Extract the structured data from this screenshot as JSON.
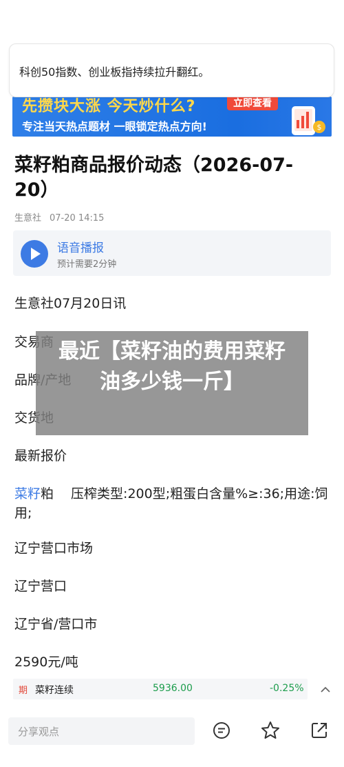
{
  "toast": {
    "text": "科创50指数、创业板指持续拉升翻红。"
  },
  "banner": {
    "headline": "先攒块大涨 今天炒什么?",
    "button_label": "立即查看",
    "subline": "专注当天热点题材 一眼锁定热点方向!"
  },
  "article": {
    "title": "菜籽粕商品报价动态（2026-07-20）",
    "source": "生意社",
    "time": "07-20 14:15",
    "audio_title": "语音播报",
    "audio_sub": "预计需要2分钟",
    "paragraphs": {
      "dateline": "生意社07月20日讯",
      "trader": "交易商",
      "brand": "品牌/产地",
      "delivery": "交货地",
      "latest": "最新报价",
      "product_link": "菜籽",
      "product_rest": "粕　 压榨类型:200型;粗蛋白含量%≥:36;用途:饲用;",
      "market": "辽宁营口市场",
      "location1": "辽宁营口",
      "location2": "辽宁省/营口市",
      "price": "2590元/吨"
    }
  },
  "overlay": {
    "text": "最近【菜籽油的费用菜籽油多少钱一斤】"
  },
  "stock": {
    "tag": "期",
    "name": "菜籽连续",
    "price": "5936.00",
    "change": "-0.25%"
  },
  "bottom": {
    "comment_placeholder": "分享观点"
  },
  "colors": {
    "accent": "#3d7be4",
    "down": "#1b9c4b",
    "tag": "#e2493a"
  }
}
